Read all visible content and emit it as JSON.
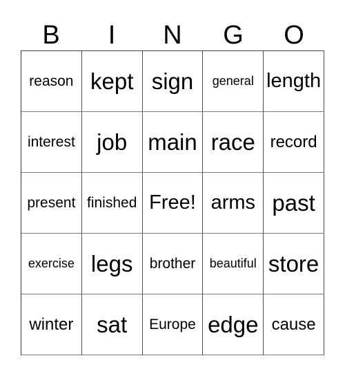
{
  "header": {
    "letters": [
      "B",
      "I",
      "N",
      "G",
      "O"
    ]
  },
  "cells": [
    [
      "reason",
      "kept",
      "sign",
      "general",
      "length"
    ],
    [
      "interest",
      "job",
      "main",
      "race",
      "record"
    ],
    [
      "present",
      "finished",
      "Free!",
      "arms",
      "past"
    ],
    [
      "exercise",
      "legs",
      "brother",
      "beautiful",
      "store"
    ],
    [
      "winter",
      "sat",
      "Europe",
      "edge",
      "cause"
    ]
  ]
}
